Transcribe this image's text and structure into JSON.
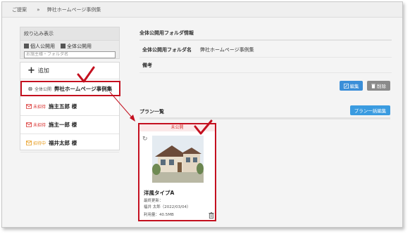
{
  "breadcrumb": {
    "items": [
      "ご提案",
      "弊社ホームページ事例集"
    ],
    "separator": "»"
  },
  "filter": {
    "title": "絞り込み表示",
    "checkboxes": [
      "個人公開用",
      "全体公開用"
    ],
    "placeholder": "お施主様・フォルダ名"
  },
  "folders": {
    "add_label": "追加",
    "items": [
      {
        "tag": "全体公開",
        "name": "弊社ホームページ事例集"
      },
      {
        "tag": "未招待",
        "name": "施主五郎 様"
      },
      {
        "tag": "未招待",
        "name": "施主一郎 様"
      },
      {
        "tag": "招待中",
        "name": "福井太郎 様"
      }
    ]
  },
  "folder_info": {
    "heading": "全体公開用フォルダ情報",
    "name_label": "全体公開用フォルダ名",
    "name_value": "弊社ホームページ事例集",
    "note_label": "備考",
    "note_value": "",
    "edit_label": "編集",
    "delete_label": "削除"
  },
  "plans": {
    "heading": "プラン一覧",
    "bulk_edit_label": "プラン一括編集",
    "card": {
      "status": "未公開",
      "title": "洋風タイプA",
      "updated_label": "最終更新：",
      "updated_value": "福井 太郎（2022/03/04）",
      "usage": "利用量：40.5MB"
    }
  },
  "colors": {
    "highlight_red": "#c4101f",
    "button_blue": "#3a8ed8",
    "button_gray": "#8a8a8a",
    "tag_wait": "#d9302e",
    "tag_progress": "#e79a1a"
  }
}
